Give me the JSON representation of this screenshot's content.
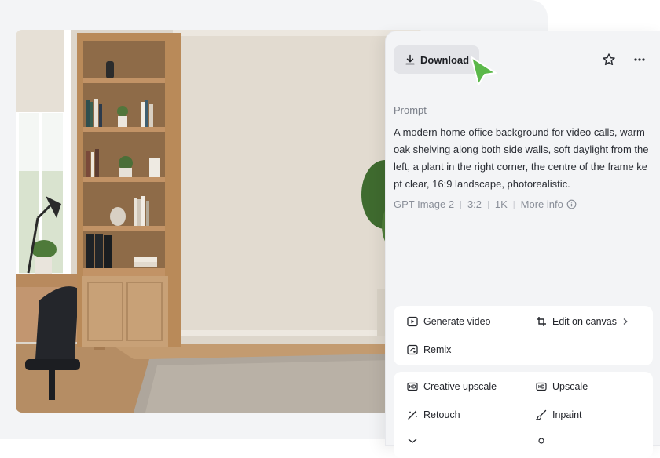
{
  "toolbar": {
    "download_label": "Download",
    "icons": [
      "download-icon",
      "star-icon",
      "more-icon"
    ]
  },
  "prompt": {
    "label": "Prompt",
    "text": "A modern home office background for video calls, warm oak shelving along both side walls, soft daylight from the left, a plant in the right corner, the centre of the frame kept clear, 16:9 landscape, photorealistic."
  },
  "meta": {
    "model": "GPT Image 2",
    "ratio": "3:2",
    "resolution": "1K",
    "more_info": "More info"
  },
  "actions_group1": [
    {
      "label": "Generate video",
      "icon": "play-icon"
    },
    {
      "label": "Edit on canvas",
      "icon": "crop-icon"
    },
    {
      "label": "Remix",
      "icon": "remix-icon"
    }
  ],
  "actions_group2": [
    {
      "label": "Creative upscale",
      "icon": "hd-creative-icon"
    },
    {
      "label": "Upscale",
      "icon": "hd-icon"
    },
    {
      "label": "Retouch",
      "icon": "magic-wand-icon"
    },
    {
      "label": "Inpaint",
      "icon": "brush-icon"
    }
  ],
  "colors": {
    "cursor": "#5bb84a",
    "panel_bg": "#f3f4f6",
    "button_bg": "#e3e4e8"
  }
}
